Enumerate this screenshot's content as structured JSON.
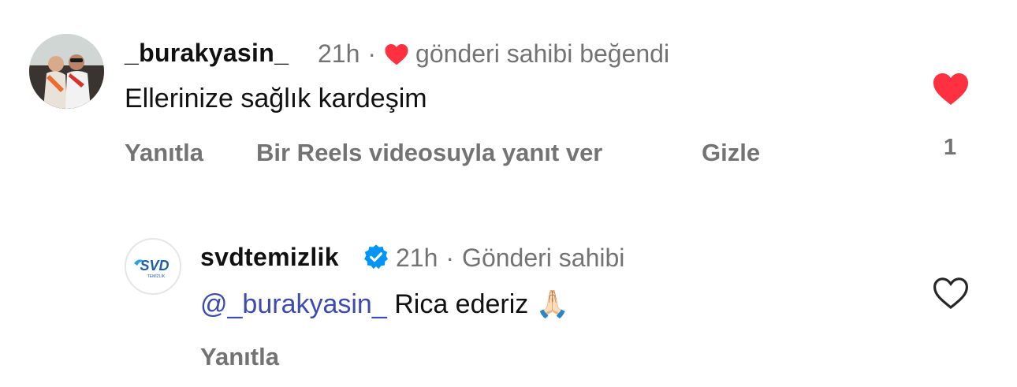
{
  "comments": [
    {
      "username": "_burakyasin_",
      "time": "21h",
      "liked_by_owner_text": "gönderi sahibi beğendi",
      "text": "Ellerinize sağlık kardeşim",
      "actions": {
        "reply": "Yanıtla",
        "reels_reply": "Bir Reels videosuyla yanıt ver",
        "hide": "Gizle"
      },
      "liked": true,
      "like_count": "1"
    },
    {
      "username": "svdtemizlik",
      "verified": true,
      "time": "21h",
      "owner_label": "Gönderi sahibi",
      "mention": "@_burakyasin_",
      "text": "Rica ederiz",
      "emoji": "🙏🏻",
      "avatar_logo_text": "SVD",
      "avatar_logo_sub": "TEMİZLİK",
      "actions": {
        "reply": "Yanıtla"
      },
      "liked": false
    }
  ],
  "colors": {
    "like_red": "#ff3040",
    "mention_blue": "#3b4bb0",
    "verified_blue": "#0095f6",
    "meta_gray": "#737373"
  }
}
